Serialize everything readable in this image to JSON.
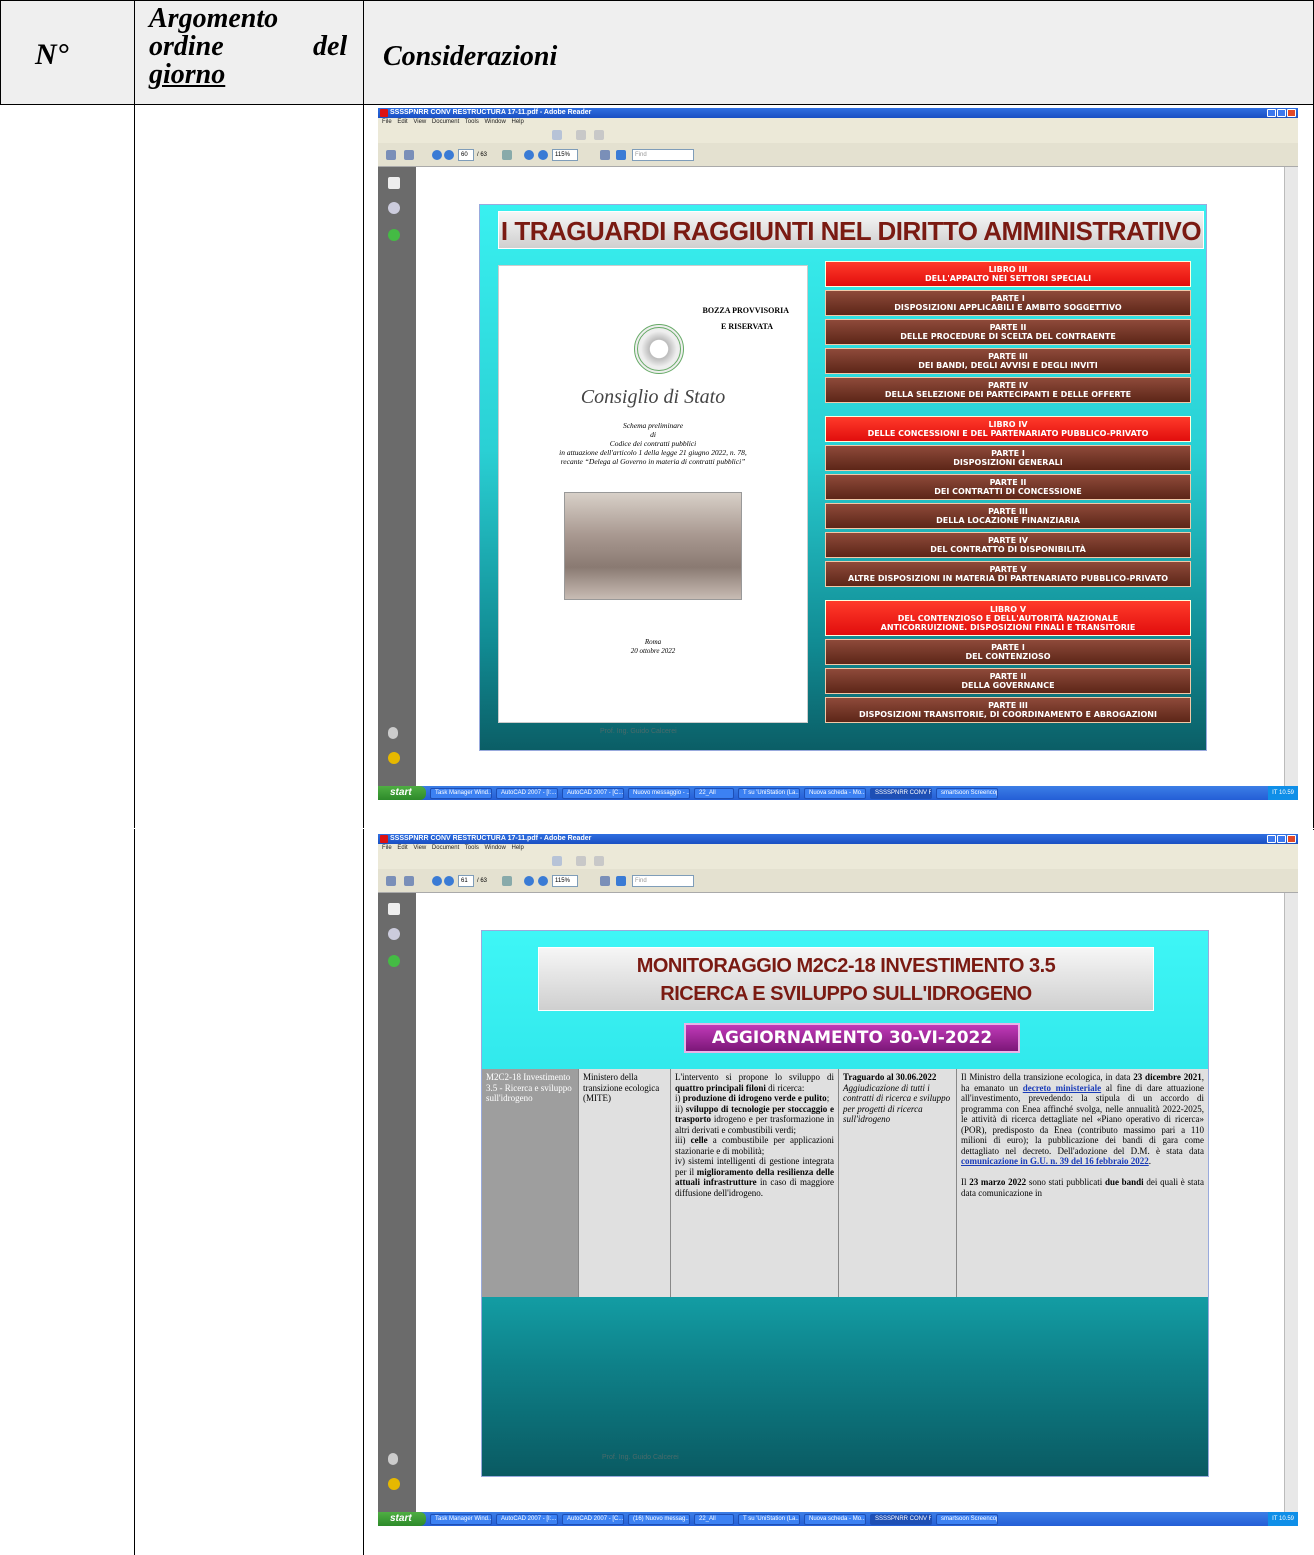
{
  "header": {
    "col_num": "N°",
    "col_topic": [
      "Argomento",
      "ordine",
      "del",
      "giorno"
    ],
    "col_notes": "Considerazioni"
  },
  "screens": [
    {
      "window_title": "SSSSPNRR CONV RESTRUCTURA 17-11.pdf - Adobe Reader",
      "menu": "File Edit View Document Tools Window Help",
      "page_num": "60",
      "page_total": "/ 63",
      "zoom": "115%",
      "find_placeholder": "Find",
      "slide_title": "I TRAGUARDI RAGGIUNTI NEL DIRITTO AMMINISTRATIVO",
      "cover": {
        "draft": "BOZZA PROVVISORIA",
        "reserved": "E RISERVATA",
        "body": "Consiglio di Stato",
        "line1": "Schema preliminare",
        "line2": "di",
        "line3": "Codice dei contratti pubblici",
        "line4": "in attuazione dell'articolo 1 della legge 21 giugno 2022, n. 78,",
        "line5": "recante “Delega al Governo in materia di contratti pubblici”",
        "place": "Roma",
        "date": "20 ottobre 2022"
      },
      "bars": [
        {
          "kind": "libro",
          "l1": "LIBRO III",
          "l2": "DELL'APPALTO NEI SETTORI SPECIALI"
        },
        {
          "kind": "parte",
          "l1": "PARTE I",
          "l2": "DISPOSIZIONI APPLICABILI E AMBITO SOGGETTIVO"
        },
        {
          "kind": "parte",
          "l1": "PARTE II",
          "l2": "DELLE PROCEDURE DI SCELTA DEL CONTRAENTE"
        },
        {
          "kind": "parte",
          "l1": "PARTE III",
          "l2": "DEI BANDI, DEGLI AVVISI E DEGLI INVITI"
        },
        {
          "kind": "parte",
          "l1": "PARTE IV",
          "l2": "DELLA SELEZIONE DEI PARTECIPANTI E DELLE OFFERTE"
        },
        {
          "kind": "libro",
          "l1": "LIBRO IV",
          "l2": "DELLE CONCESSIONI E DEL PARTENARIATO PUBBLICO-PRIVATO"
        },
        {
          "kind": "parte",
          "l1": "PARTE I",
          "l2": "DISPOSIZIONI GENERALI"
        },
        {
          "kind": "parte",
          "l1": "PARTE II",
          "l2": "DEI CONTRATTI DI CONCESSIONE"
        },
        {
          "kind": "parte",
          "l1": "PARTE III",
          "l2": "DELLA LOCAZIONE FINANZIARIA"
        },
        {
          "kind": "parte",
          "l1": "PARTE IV",
          "l2": "DEL CONTRATTO DI DISPONIBILITÀ"
        },
        {
          "kind": "parte",
          "l1": "PARTE V",
          "l2": "ALTRE DISPOSIZIONI IN MATERIA DI PARTENARIATO PUBBLICO-PRIVATO"
        },
        {
          "kind": "libro",
          "l1": "LIBRO V",
          "l2": "DEL CONTENZIOSO E DELL'AUTORITÀ NAZIONALE",
          "l3": "ANTICORRUIZIONE. DISPOSIZIONI FINALI E TRANSITORIE"
        },
        {
          "kind": "parte",
          "l1": "PARTE I",
          "l2": "DEL CONTENZIOSO"
        },
        {
          "kind": "parte",
          "l1": "PARTE II",
          "l2": "DELLA GOVERNANCE"
        },
        {
          "kind": "parte",
          "l1": "PARTE III",
          "l2": "DISPOSIZIONI TRANSITORIE, DI COORDINAMENTO E ABROGAZIONI"
        }
      ],
      "footer": "Prof. Ing. Guido Calcerei",
      "taskbar": {
        "start": "start",
        "tasks": [
          "Task Manager Wind...",
          "AutoCAD 2007 - [I:...",
          "AutoCAD 2007 - [C...",
          "Nuovo messaggio - ...",
          "22_All",
          "T su 'UniStation (La...",
          "Nuova scheda - Mo...",
          "SSSSPNRR CONV R...",
          "smartsoon Screencopy"
        ],
        "tray": "IT  10.59"
      }
    },
    {
      "window_title": "SSSSPNRR CONV RESTRUCTURA 17-11.pdf - Adobe Reader",
      "menu": "File Edit View Document Tools Window Help",
      "page_num": "61",
      "page_total": "/ 63",
      "zoom": "115%",
      "find_placeholder": "Find",
      "slide_title_1": "MONITORAGGIO M2C2-18 INVESTIMENTO 3.5",
      "slide_title_2": "RICERCA E SVILUPPO SULL'IDROGENO",
      "update_banner": "AGGIORNAMENTO  30-VI-2022",
      "table": {
        "c1": "M2C2-18 Investimento 3.5 - Ricerca e sviluppo sull'idrogeno",
        "c2": "Ministero della transizione ecologica (MITE)",
        "c3_html": "L'intervento si propone lo sviluppo di <b>quattro principali filoni</b> di ricerca:<br>i) <b>produzione di idrogeno verde e pulito</b>;<br>ii) <b>sviluppo di tecnologie per stoccaggio e trasporto</b> idrogeno e per trasformazione in altri derivati e combustibili verdi;<br>iii) <b>celle</b> a combustibile per applicazioni stazionarie e di mobilità;<br>iv) sistemi intelligenti di gestione integrata per il <b>miglioramento della resilienza delle attuali infrastrutture</b> in caso di maggiore diffusione dell'idrogeno.",
        "c4_title": "Traguardo al 30.06.2022",
        "c4_body": "Aggiudicazione di tutti i contratti di ricerca e sviluppo per progetti di ricerca sull'idrogeno",
        "c5_html": "Il Ministro della transizione ecologica, in data <b>23 dicembre 2021</b>, ha emanato un <u>decreto ministeriale</u> al fine di dare attuazione all'investimento, prevedendo: la stipula di un accordo di programma con Enea affinché svolga, nelle annualità 2022-2025, le attività di ricerca dettagliate nel «Piano operativo di ricerca» (POR), predisposto da Enea (contributo massimo pari a 110 milioni di euro); la pubblicazione dei bandi di gara come dettagliato nel decreto. Dell'adozione del D.M. è stata data <u>comunicazione in G.U. n. 39 del 16 febbraio 2022</u>.<br><br>Il <b>23 marzo 2022</b> sono stati pubblicati <b>due bandi</b> dei quali è stata data comunicazione in"
      },
      "footer": "Prof. Ing. Guido Calcerei",
      "taskbar": {
        "start": "start",
        "tasks": [
          "Task Manager Wind...",
          "AutoCAD 2007 - [I:...",
          "AutoCAD 2007 - [C...",
          "(16) Nuovo messag...",
          "22_All",
          "T su 'UniStation (La...",
          "Nuova scheda - Mo...",
          "SSSSPNRR CONV R...",
          "smartsoon Screencopy"
        ],
        "tray": "IT  10.59"
      }
    }
  ]
}
